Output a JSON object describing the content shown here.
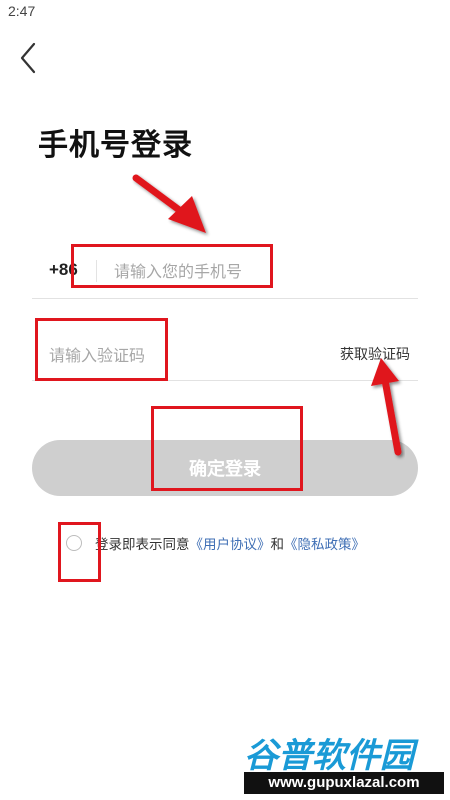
{
  "status_bar": {
    "time": "2:47"
  },
  "header": {
    "back_icon": "chevron-left-icon"
  },
  "page": {
    "title": "手机号登录"
  },
  "phone": {
    "country_code": "+86",
    "placeholder": "请输入您的手机号",
    "value": ""
  },
  "code": {
    "placeholder": "请输入验证码",
    "value": "",
    "get_code_label": "获取验证码"
  },
  "login": {
    "label": "确定登录"
  },
  "agreement": {
    "checked": false,
    "prefix": "登录即表示同意",
    "user_agreement": "《用户协议》",
    "conjunction": "和",
    "privacy_policy": "《隐私政策》"
  },
  "watermark": {
    "logo_text": "谷普软件园",
    "url_text": "www.gupuxlazal.com"
  },
  "colors": {
    "annotation_red": "#e0161e",
    "link_blue": "#3f6fb5",
    "disabled_button": "#cfcfcf"
  }
}
